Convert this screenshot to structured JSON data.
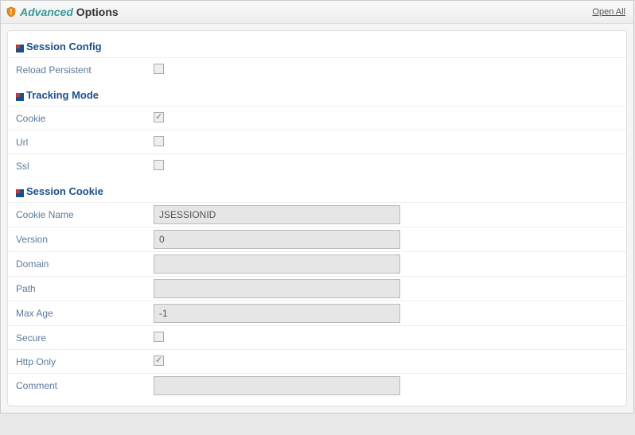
{
  "header": {
    "title_advanced": "Advanced",
    "title_options": " Options",
    "open_all": "Open All"
  },
  "sections": {
    "session_config": {
      "title": "Session Config",
      "rows": {
        "reload_persistent": {
          "label": "Reload Persistent",
          "checked": false
        }
      }
    },
    "tracking_mode": {
      "title": "Tracking Mode",
      "rows": {
        "cookie": {
          "label": "Cookie",
          "checked": true
        },
        "url": {
          "label": "Url",
          "checked": false
        },
        "ssl": {
          "label": "Ssl",
          "checked": false
        }
      }
    },
    "session_cookie": {
      "title": "Session Cookie",
      "rows": {
        "cookie_name": {
          "label": "Cookie Name",
          "value": "JSESSIONID"
        },
        "version": {
          "label": "Version",
          "value": "0"
        },
        "domain": {
          "label": "Domain",
          "value": ""
        },
        "path": {
          "label": "Path",
          "value": ""
        },
        "max_age": {
          "label": "Max Age",
          "value": "-1"
        },
        "secure": {
          "label": "Secure",
          "checked": false
        },
        "http_only": {
          "label": "Http Only",
          "checked": true
        },
        "comment": {
          "label": "Comment",
          "value": ""
        }
      }
    }
  }
}
